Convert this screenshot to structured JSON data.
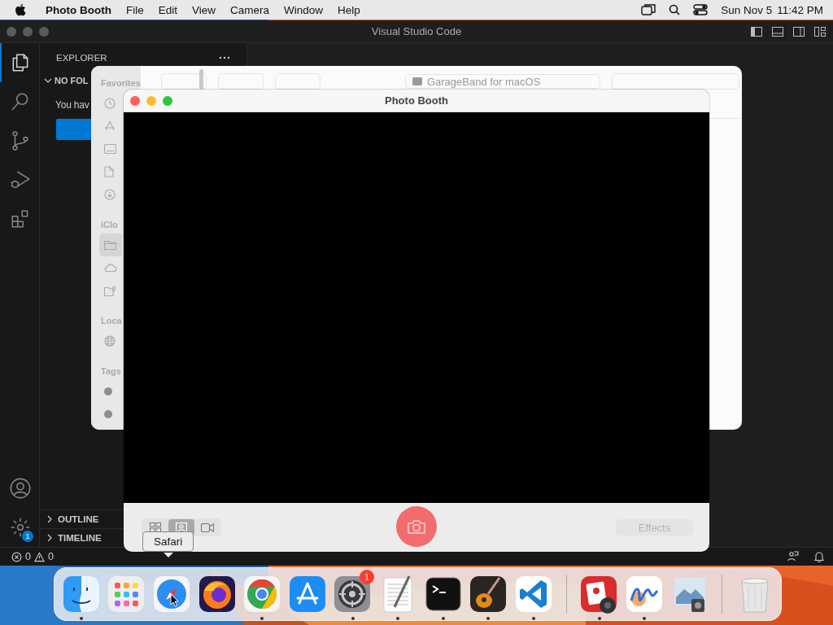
{
  "menu_bar": {
    "app": "Photo Booth",
    "menus": [
      "File",
      "Edit",
      "View",
      "Camera",
      "Window",
      "Help"
    ],
    "date": "Sun Nov 5",
    "time": "11:42 PM"
  },
  "vscode": {
    "title": "Visual Studio Code",
    "activity_items": [
      {
        "kind": "files",
        "selected": true
      },
      {
        "kind": "search",
        "selected": false
      },
      {
        "kind": "source-control",
        "selected": false
      },
      {
        "kind": "run-debug",
        "selected": false
      },
      {
        "kind": "extensions",
        "selected": false
      }
    ],
    "settings_badge": "1",
    "sidebar": {
      "title": "EXPLORER",
      "section": "NO FOL",
      "message": "You hav",
      "panels": [
        "OUTLINE",
        "TIMELINE"
      ]
    },
    "status_bar": {
      "errors": "0",
      "warnings": "0"
    }
  },
  "finder_dialog": {
    "location": "GarageBand for macOS",
    "sections": [
      {
        "title": "Favorites",
        "items": [
          {
            "kind": "clock",
            "selected": false
          },
          {
            "kind": "apps",
            "selected": false
          },
          {
            "kind": "drive",
            "selected": false
          },
          {
            "kind": "document",
            "selected": false
          },
          {
            "kind": "download",
            "selected": false
          }
        ]
      },
      {
        "title": "iClo",
        "items": [
          {
            "kind": "folder",
            "selected": true
          },
          {
            "kind": "cloud",
            "selected": false
          },
          {
            "kind": "shared-folder",
            "selected": false
          }
        ]
      },
      {
        "title": "Loca",
        "items": [
          {
            "kind": "globe",
            "selected": false
          }
        ]
      },
      {
        "title": "Tags",
        "items": [
          {
            "kind": "tag",
            "selected": false
          },
          {
            "kind": "tag",
            "selected": false
          }
        ]
      }
    ]
  },
  "photo_booth": {
    "title": "Photo Booth",
    "view_modes": [
      {
        "kind": "grid",
        "selected": false
      },
      {
        "kind": "single",
        "selected": true
      },
      {
        "kind": "video",
        "selected": false
      }
    ],
    "effects": {
      "label": "Effects",
      "disabled": true
    }
  },
  "dock": {
    "tooltip": "Safari",
    "apps": [
      {
        "kind": "finder",
        "running": true
      },
      {
        "kind": "launchpad",
        "running": false
      },
      {
        "kind": "safari",
        "running": false
      },
      {
        "kind": "firefox",
        "running": false
      },
      {
        "kind": "chrome",
        "running": true
      },
      {
        "kind": "appstore",
        "running": false
      },
      {
        "kind": "settings",
        "running": true,
        "badge": "1"
      },
      {
        "kind": "textedit",
        "running": true
      },
      {
        "kind": "terminal",
        "running": true
      },
      {
        "kind": "garageband",
        "running": true
      },
      {
        "kind": "vscode",
        "running": true
      },
      {
        "kind": "divider"
      },
      {
        "kind": "photobooth",
        "running": true
      },
      {
        "kind": "freeform",
        "running": true
      },
      {
        "kind": "preview",
        "running": false
      },
      {
        "kind": "divider"
      },
      {
        "kind": "trash",
        "running": false
      }
    ]
  }
}
